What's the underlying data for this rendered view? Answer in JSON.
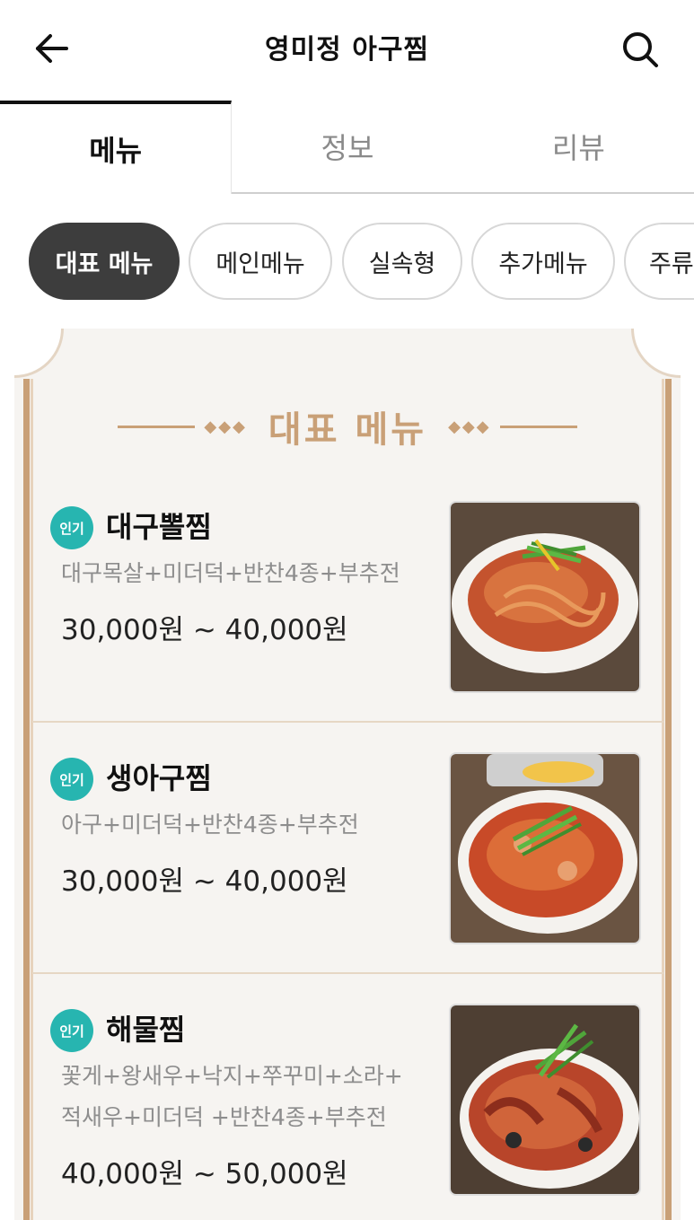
{
  "header": {
    "title": "영미정 아구찜",
    "back_icon": "arrow-left-icon",
    "search_icon": "search-icon"
  },
  "tabs": [
    {
      "label": "메뉴",
      "active": true
    },
    {
      "label": "정보",
      "active": false
    },
    {
      "label": "리뷰",
      "active": false
    }
  ],
  "categories": [
    {
      "label": "대표 메뉴",
      "active": true
    },
    {
      "label": "메인메뉴",
      "active": false
    },
    {
      "label": "실속형",
      "active": false
    },
    {
      "label": "추가메뉴",
      "active": false
    },
    {
      "label": "주류",
      "active": false
    }
  ],
  "section": {
    "title": "대표 메뉴"
  },
  "menu_items": [
    {
      "badge": "인기",
      "name": "대구뽈찜",
      "description_lines": [
        "대구목살+미더덕+반찬4종+부추전"
      ],
      "price": "30,000원 ~ 40,000원"
    },
    {
      "badge": "인기",
      "name": "생아구찜",
      "description_lines": [
        "아구+미더덕+반찬4종+부추전"
      ],
      "price": "30,000원 ~ 40,000원"
    },
    {
      "badge": "인기",
      "name": "해물찜",
      "description_lines": [
        "꽃게+왕새우+낙지+쭈꾸미+소라+",
        "적새우+미더덕 +반찬4종+부추전"
      ],
      "price": "40,000원 ~ 50,000원"
    }
  ],
  "colors": {
    "accent_gold": "#c9a077",
    "badge_teal": "#27b5b0",
    "chip_active": "#3d3d3d",
    "card_bg": "#f6f4f1"
  }
}
